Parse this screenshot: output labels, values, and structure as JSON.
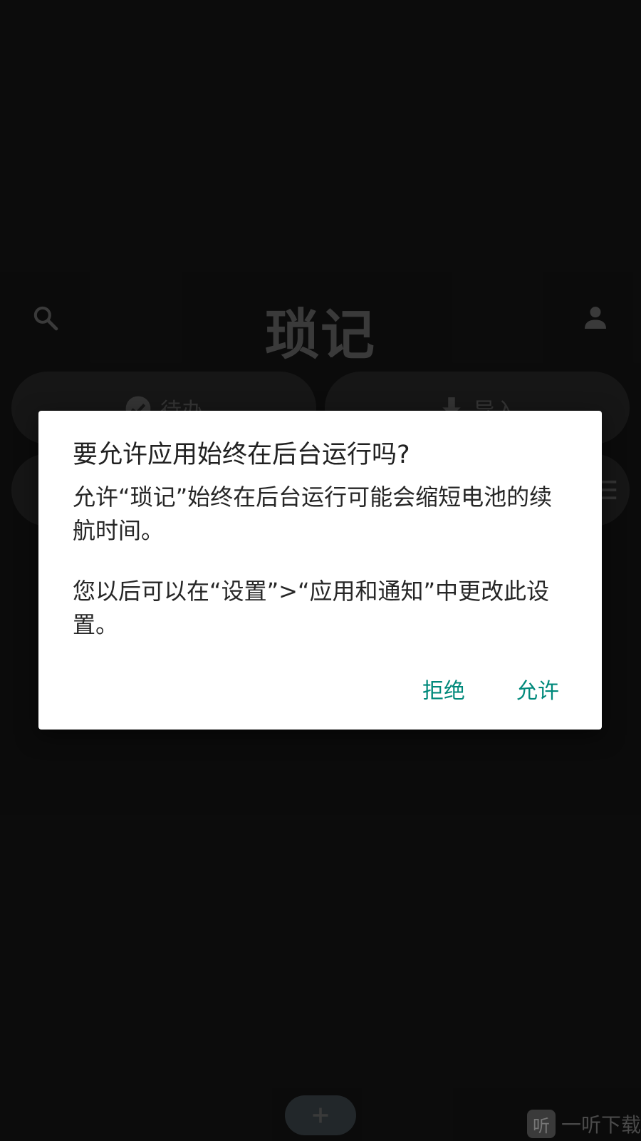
{
  "app": {
    "title": "琐记",
    "tiles": {
      "todo_label": "待办",
      "import_label": "导入"
    },
    "fab_icon": "plus-icon"
  },
  "dialog": {
    "title": "要允许应用始终在后台运行吗?",
    "body_paragraph_1": "允许“琐记”始终在后台运行可能会缩短电池的续航时间。",
    "body_paragraph_2": "您以后可以在“设置”>“应用和通知”中更改此设置。",
    "deny_label": "拒绝",
    "allow_label": "允许",
    "accent_color": "#00897b"
  },
  "watermark": {
    "logo_text": "听",
    "text": "一听下载"
  }
}
